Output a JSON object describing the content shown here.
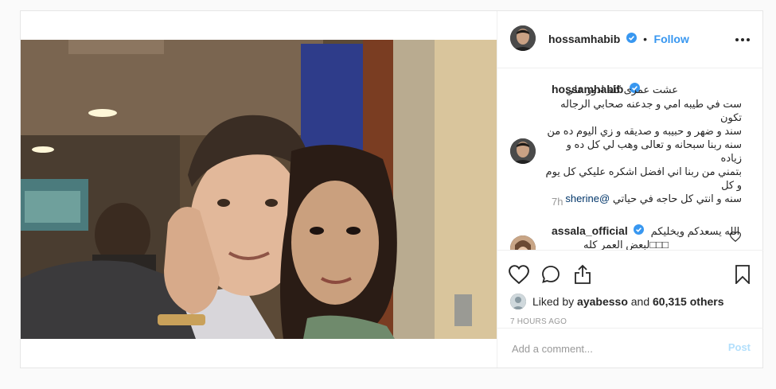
{
  "post": {
    "author": "hossamhabib",
    "follow_label": "Follow",
    "separator": "•",
    "caption_lines": [
      "عشت عمرى كله ادور علي",
      "ست في طيبه امي و جدعنه صحابي الرجاله تكون",
      "سند و ضهر و حبيبه و صديقه و زي اليوم ده من",
      "سنه ربنا سبحانه و تعالى وهب لي كل ده و زياده",
      "بتمني من ربنا اني افضل اشكره عليكي كل يوم و كل",
      "سنه و انتي كل حاجه في حياتي"
    ],
    "mention": "@sherine",
    "time_short": "7h",
    "comment": {
      "author": "assala_official",
      "text_line1": "الله يسعدكم ويخليكم",
      "text_line2": "لبعض العمر كله□□□"
    },
    "likes": {
      "prefix": "Liked by",
      "user": "ayabesso",
      "middle": "and",
      "count": "60,315 others"
    },
    "time_long": "7 HOURS AGO",
    "comment_placeholder": "Add a comment...",
    "post_label": "Post"
  },
  "colors": {
    "accent": "#3897f0",
    "post_disabled": "#b2dffc",
    "verified": "#3897f0"
  },
  "icons": [
    "more-icon",
    "verified-icon",
    "heart-icon",
    "comment-icon",
    "share-icon",
    "bookmark-icon",
    "small-heart-icon"
  ]
}
